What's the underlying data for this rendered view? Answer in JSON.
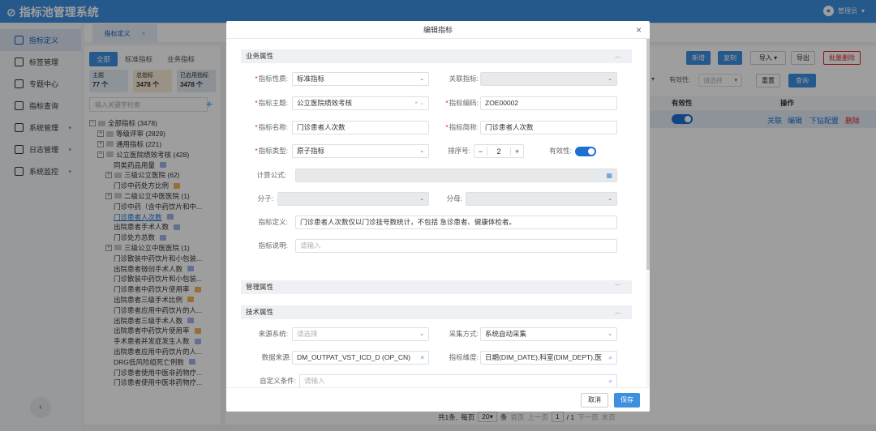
{
  "app": {
    "title": "指标池管理系统",
    "user": "管理员"
  },
  "sidebar": {
    "items": [
      {
        "label": "指标定义",
        "active": true
      },
      {
        "label": "标签管理"
      },
      {
        "label": "专题中心"
      },
      {
        "label": "指标查询"
      },
      {
        "label": "系统管理",
        "expand": true
      },
      {
        "label": "日志管理",
        "expand": true
      },
      {
        "label": "系统监控",
        "expand": true
      }
    ],
    "collapse_icon": "‹"
  },
  "tabs": [
    {
      "label": "指标定义",
      "close": "×"
    }
  ],
  "left_panel": {
    "cat_tabs": [
      "全部",
      "标准指标",
      "业务指标"
    ],
    "stats": [
      {
        "label": "主题",
        "value": "77 个",
        "bg": "#e6eef9"
      },
      {
        "label": "总指标",
        "value": "3478 个",
        "bg": "#fbecd9"
      },
      {
        "label": "已启用指标",
        "value": "3478 个",
        "bg": "#e3eaf3"
      }
    ],
    "search_placeholder": "输入关键字检索",
    "tree": [
      {
        "text": "全部指标 (3478)",
        "pm": "−",
        "indent": 0,
        "folder": true
      },
      {
        "text": "等级评审 (2829)",
        "pm": "+",
        "indent": 1,
        "folder": true
      },
      {
        "text": "通用指标 (221)",
        "pm": "+",
        "indent": 1,
        "folder": true
      },
      {
        "text": "公立医院绩效考核 (428)",
        "pm": "−",
        "indent": 1,
        "folder": true
      },
      {
        "text": "同类药品用量",
        "indent": 2,
        "tag": "#a1b3e8"
      },
      {
        "text": "三级公立医院 (62)",
        "pm": "+",
        "indent": 2,
        "folder": true
      },
      {
        "text": "门诊中药处方比例",
        "indent": 2,
        "tag": "#f0b45a"
      },
      {
        "text": "二级公立中医医院 (1)",
        "pm": "+",
        "indent": 2,
        "folder": true
      },
      {
        "text": "门诊中药（含中药饮片和中...",
        "indent": 2
      },
      {
        "text": "门诊患者人次数",
        "indent": 2,
        "sel": true,
        "tag": "#a1b3e8"
      },
      {
        "text": "出院患者手术人数",
        "indent": 2,
        "tag": "#a1b3e8"
      },
      {
        "text": "门诊处方总数",
        "indent": 2,
        "tag": "#a1b3e8"
      },
      {
        "text": "三级公立中医医院 (1)",
        "pm": "+",
        "indent": 2,
        "folder": true
      },
      {
        "text": "门诊散装中药饮片和小包装...",
        "indent": 2
      },
      {
        "text": "出院患者微创手术人数",
        "indent": 2,
        "tag": "#a1b3e8"
      },
      {
        "text": "门诊散装中药饮片和小包装...",
        "indent": 2
      },
      {
        "text": "门诊患者中药饮片使用率",
        "indent": 2,
        "tag": "#f0b45a"
      },
      {
        "text": "出院患者三级手术比例",
        "indent": 2,
        "tag": "#f0b45a"
      },
      {
        "text": "门诊患者应用中药饮片的人...",
        "indent": 2
      },
      {
        "text": "出院患者三级手术人数",
        "indent": 2,
        "tag": "#a1b3e8"
      },
      {
        "text": "出院患者中药饮片使用率",
        "indent": 2,
        "tag": "#f0b45a"
      },
      {
        "text": "手术患者并发症发生人数",
        "indent": 2,
        "tag": "#a1b3e8"
      },
      {
        "text": "出院患者应用中药饮片的人...",
        "indent": 2
      },
      {
        "text": "DRG低风险组死亡例数",
        "indent": 2,
        "tag": "#a1b3e8"
      },
      {
        "text": "门诊患者使用中医非药物疗...",
        "indent": 2
      },
      {
        "text": "门诊患者使用中医非药物疗...",
        "indent": 2
      }
    ]
  },
  "toolbar": {
    "add": "新增",
    "copy": "复制",
    "import": "导入",
    "export": "导出",
    "batch_delete": "批量删除",
    "validity_label": "有效性:",
    "validity_placeholder": "请选择",
    "reset": "重置",
    "query": "查询"
  },
  "table": {
    "headers": [
      "有效性",
      "操作"
    ],
    "row_actions": [
      "关联",
      "编辑",
      "下钻配置",
      "删除"
    ],
    "row_valid": true
  },
  "pagination": {
    "total": "共1条,",
    "per_page_label": "每页",
    "per_page": "20",
    "unit": "条",
    "first": "首页",
    "prev": "上一页",
    "page": "1",
    "of": "/ 1",
    "next": "下一页",
    "last": "末页"
  },
  "modal": {
    "title": "编辑指标",
    "close": "×",
    "sections": {
      "business": "业务属性",
      "management": "管理属性",
      "technical": "技术属性"
    },
    "fields": {
      "nature": {
        "label": "指标性质:",
        "value": "标准指标"
      },
      "related": {
        "label": "关联指标:",
        "value": ""
      },
      "theme": {
        "label": "指标主题:",
        "value": "公立医院绩效考核"
      },
      "code": {
        "label": "指标编码:",
        "value": "ZOE00002"
      },
      "name": {
        "label": "指标名称:",
        "value": "门诊患者人次数"
      },
      "short_name": {
        "label": "指标简称:",
        "value": "门诊患者人次数"
      },
      "type": {
        "label": "指标类型:",
        "value": "原子指标"
      },
      "sort": {
        "label": "排序号:",
        "value": "2"
      },
      "valid": {
        "label": "有效性:",
        "value": true
      },
      "formula": {
        "label": "计算公式:",
        "value": ""
      },
      "numerator": {
        "label": "分子:",
        "value": ""
      },
      "denominator": {
        "label": "分母:",
        "value": ""
      },
      "definition": {
        "label": "指标定义:",
        "value": "门诊患者人次数仅以门诊挂号数统计，不包括 急诊患者、健康体检者。"
      },
      "description": {
        "label": "指标说明:",
        "placeholder": "请输入"
      },
      "source_system": {
        "label": "来源系统:",
        "placeholder": "请选择"
      },
      "collect_method": {
        "label": "采集方式:",
        "value": "系统自动采集"
      },
      "data_source": {
        "label": "数据来源:",
        "value": "DM_OUTPAT_VST_ICD_D (OP_CN)"
      },
      "dimension": {
        "label": "指标维度:",
        "value": "日期(DIM_DATE),科室(DIM_DEPT),医"
      },
      "custom_cond": {
        "label": "自定义条件:",
        "placeholder": "请输入"
      }
    },
    "cancel": "取消",
    "save": "保存"
  },
  "colors": {
    "primary": "#3d8fe0",
    "danger": "#e0252b",
    "toggle": "#1e6fd0"
  }
}
